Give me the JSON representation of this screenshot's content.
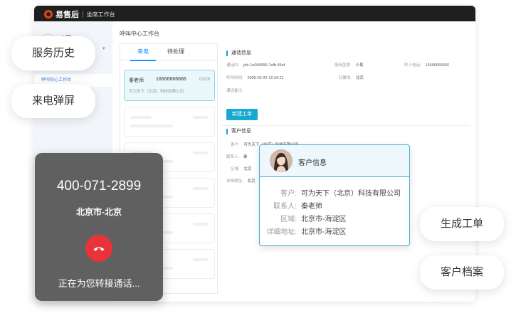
{
  "app": {
    "brand": "易售后",
    "subtitle": "坐席工作台",
    "user_name": "小寒",
    "sidebar_item": "呼叫中心工作台",
    "page_title": "呼叫中心工作台"
  },
  "left_panel": {
    "tabs": [
      {
        "label": "来电",
        "active": true
      },
      {
        "label": "待处理",
        "active": false
      }
    ],
    "call_card": {
      "name": "秦老师",
      "phone": "16666666666",
      "date": "02/26",
      "company": "可为天下（北京）科技有限公司"
    }
  },
  "call_info": {
    "section_title": "通话信息",
    "fields": [
      {
        "label": "通话ID:",
        "value": "job-1e084996-1cfb-45ef"
      },
      {
        "label": "接待坐席:",
        "value": "小易"
      },
      {
        "label": "呼入电话:",
        "value": "16666666666"
      },
      {
        "label": "呼叫时间:",
        "value": "2025-02-26 12:34:21"
      },
      {
        "label": "归属地:",
        "value": "北京"
      },
      {
        "label": "通话备注:",
        "value": ""
      }
    ],
    "new_order_button": "新建工单"
  },
  "customer_section": {
    "section_title": "客户信息",
    "fields": [
      {
        "label": "客户:",
        "value": "可为天下（北京）科技有限公司"
      },
      {
        "label": "联系人:",
        "value": "秦"
      },
      {
        "label": "区域:",
        "value": "北京"
      },
      {
        "label": "详细地址:",
        "value": "北京"
      }
    ]
  },
  "feature_pills": {
    "history": "服务历史",
    "popup": "来电弹屏",
    "generate": "生成工单",
    "archive": "客户档案"
  },
  "incoming_call": {
    "number": "400-071-2899",
    "location": "北京市-北京",
    "status": "正在为您转接通话..."
  },
  "customer_popup": {
    "title": "客户信息",
    "rows": [
      {
        "label": "客户:",
        "value": "可为天下（北京）科技有限公司"
      },
      {
        "label": "联系人:",
        "value": "秦老师"
      },
      {
        "label": "区域:",
        "value": "北京市-海淀区"
      },
      {
        "label": "详细地址:",
        "value": "北京市-海淀区"
      }
    ]
  },
  "colors": {
    "accent": "#17a9cf",
    "tab_active": "#1890ff",
    "hangup": "#e8333a",
    "topbar": "#1f1f1f"
  }
}
